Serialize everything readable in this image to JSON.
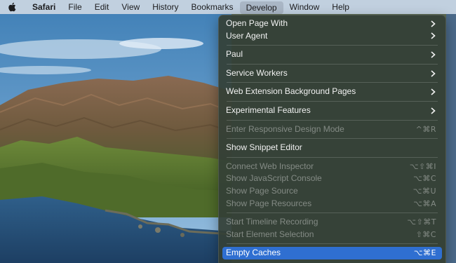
{
  "menubar": {
    "apple_icon": "apple-logo-icon",
    "items": [
      {
        "label": "Safari"
      },
      {
        "label": "File"
      },
      {
        "label": "Edit"
      },
      {
        "label": "View"
      },
      {
        "label": "History"
      },
      {
        "label": "Bookmarks"
      },
      {
        "label": "Develop"
      },
      {
        "label": "Window"
      },
      {
        "label": "Help"
      }
    ],
    "active_item": "Develop"
  },
  "develop_menu": {
    "items": [
      {
        "label": "Open Page With",
        "submenu": true
      },
      {
        "label": "User Agent",
        "submenu": true
      },
      {
        "label": "Paul",
        "submenu": true
      },
      {
        "label": "Service Workers",
        "submenu": true
      },
      {
        "label": "Web Extension Background Pages",
        "submenu": true
      },
      {
        "label": "Experimental Features",
        "submenu": true
      },
      {
        "label": "Enter Responsive Design Mode",
        "shortcut": "^⌘R",
        "disabled": true
      },
      {
        "label": "Show Snippet Editor"
      },
      {
        "label": "Connect Web Inspector",
        "shortcut": "⌥⇧⌘I",
        "disabled": true
      },
      {
        "label": "Show JavaScript Console",
        "shortcut": "⌥⌘C",
        "disabled": true
      },
      {
        "label": "Show Page Source",
        "shortcut": "⌥⌘U",
        "disabled": true
      },
      {
        "label": "Show Page Resources",
        "shortcut": "⌥⌘A",
        "disabled": true
      },
      {
        "label": "Start Timeline Recording",
        "shortcut": "⌥⇧⌘T",
        "disabled": true
      },
      {
        "label": "Start Element Selection",
        "shortcut": "⇧⌘C",
        "disabled": true
      },
      {
        "label": "Empty Caches",
        "shortcut": "⌥⌘E",
        "selected": true
      }
    ]
  },
  "colors": {
    "menu_background": "#344036",
    "selection_highlight": "#2f6fd1",
    "menubar_background": "#d6dde5"
  }
}
